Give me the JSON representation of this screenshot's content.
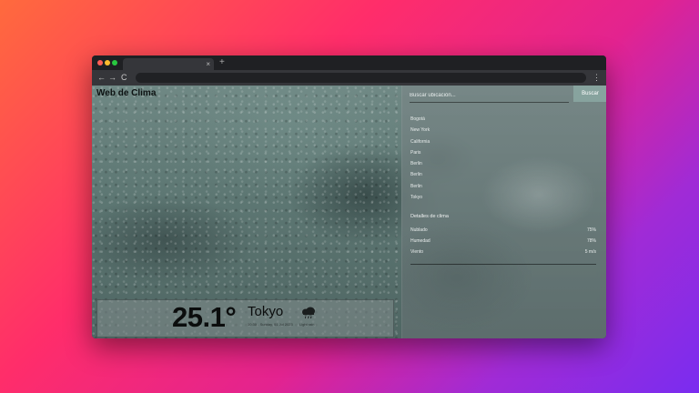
{
  "browser": {
    "tab_close": "×",
    "new_tab": "+",
    "back": "←",
    "forward": "→",
    "reload": "C",
    "menu": "⋮"
  },
  "app": {
    "title": "Web de Clima"
  },
  "search": {
    "placeholder": "Buscar ubicación...",
    "button_label": "Buscar"
  },
  "cities": [
    "Bogotá",
    "New York",
    "California",
    "Paris",
    "Berlin",
    "Berlin",
    "Berlin",
    "Tokyo"
  ],
  "details": {
    "heading": "Detalles de clima",
    "rows": [
      {
        "label": "Nublado",
        "value": "75%"
      },
      {
        "label": "Humedad",
        "value": "78%"
      },
      {
        "label": "Viento",
        "value": "5 m/s"
      }
    ]
  },
  "current": {
    "temperature": "25.1°",
    "city": "Tokyo",
    "datetime": "10:30 - Sunday, 01 Jul 2023",
    "condition": "Light rain",
    "icon": "rain-cloud-icon"
  }
}
